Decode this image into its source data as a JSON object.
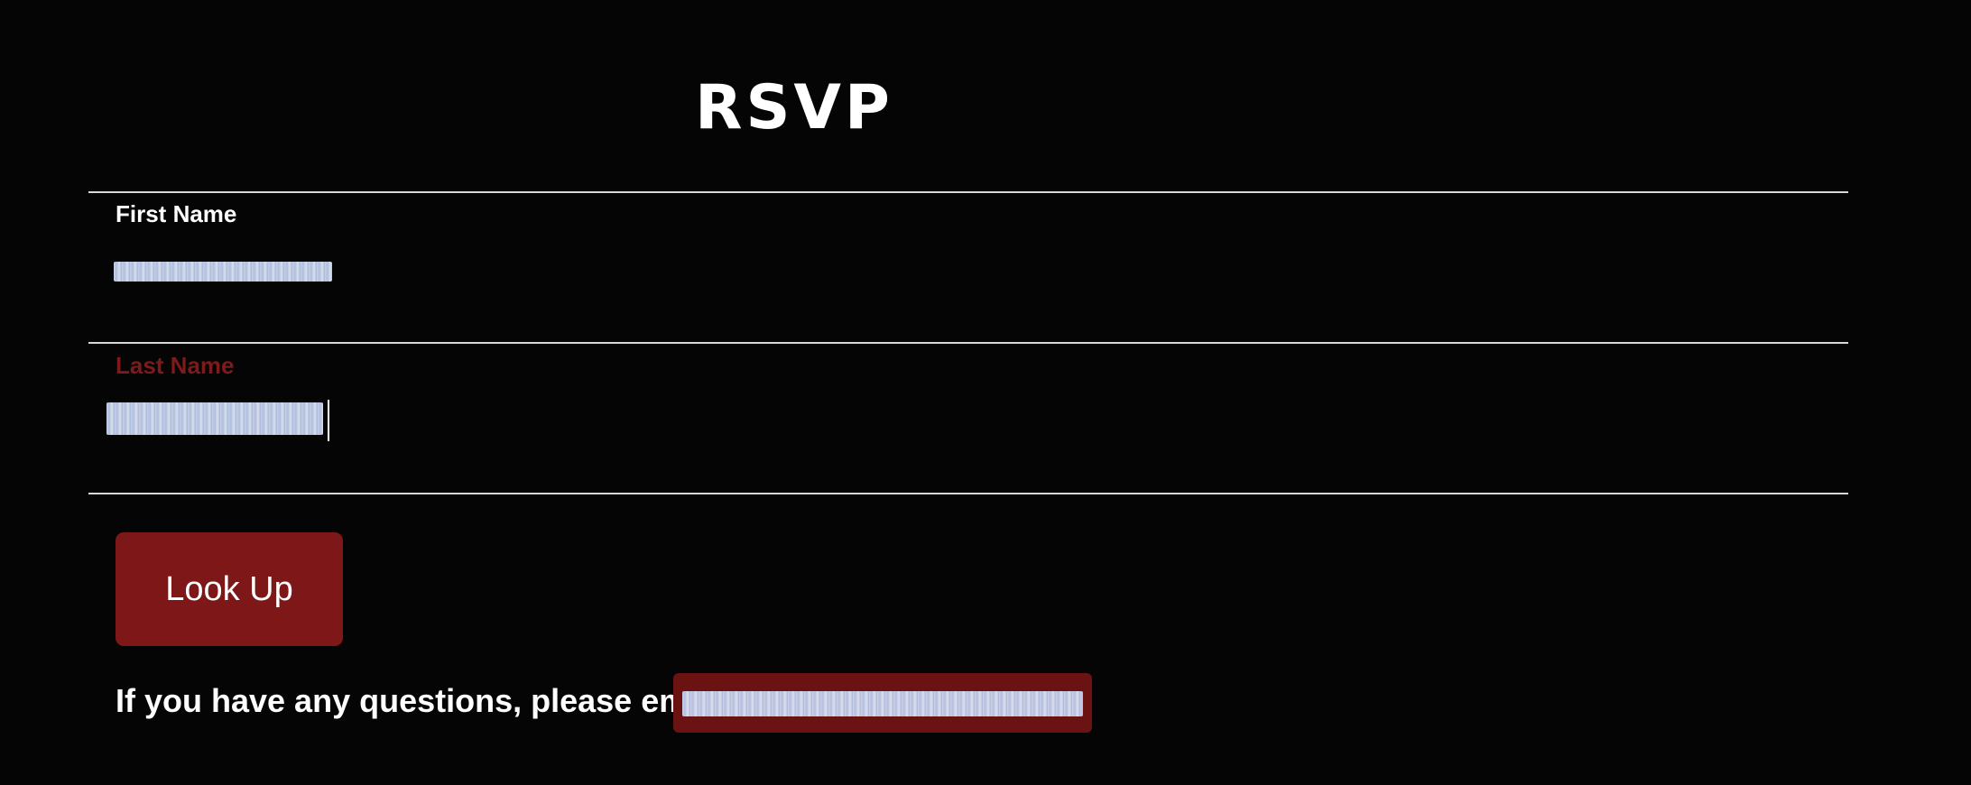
{
  "page": {
    "title": "RSVP"
  },
  "form": {
    "first_name": {
      "label": "First Name",
      "value": ""
    },
    "last_name": {
      "label": "Last Name",
      "value": ""
    },
    "lookup_button_label": "Look Up"
  },
  "footer": {
    "help_text": "If you have any questions, please email"
  },
  "colors": {
    "background": "#050505",
    "accent": "#7e1717",
    "active_label": "#7d1a1a",
    "text": "#ffffff",
    "divider": "#d8d8d8"
  }
}
